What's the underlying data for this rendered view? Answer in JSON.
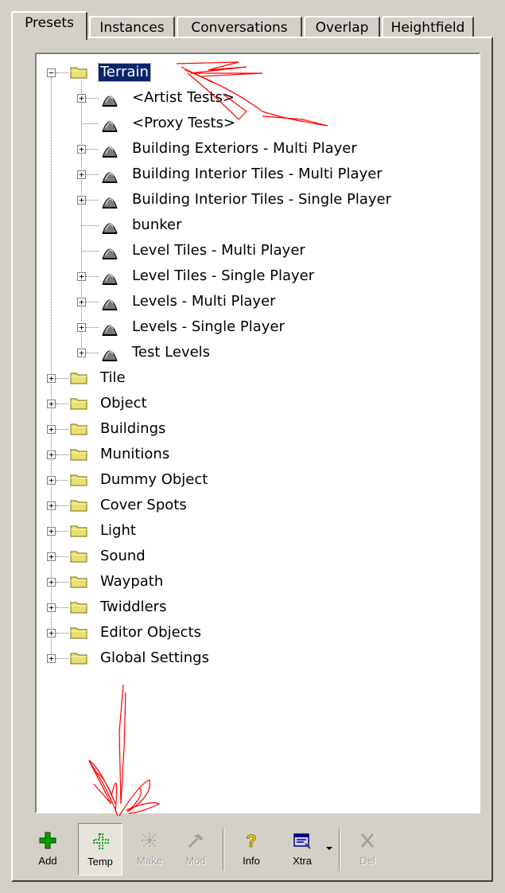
{
  "tabs": [
    {
      "label": "Presets",
      "active": true
    },
    {
      "label": "Instances",
      "active": false
    },
    {
      "label": "Conversations",
      "active": false
    },
    {
      "label": "Overlap",
      "active": false
    },
    {
      "label": "Heightfield",
      "active": false
    }
  ],
  "tree": {
    "root": {
      "label": "Terrain",
      "expanded": true,
      "selected": true
    },
    "terrain_children": [
      {
        "label": "<Artist Tests>",
        "expandable": true
      },
      {
        "label": "<Proxy Tests>",
        "expandable": false
      },
      {
        "label": "Building Exteriors - Multi Player",
        "expandable": true
      },
      {
        "label": "Building Interior Tiles - Multi Player",
        "expandable": true
      },
      {
        "label": "Building Interior Tiles - Single Player",
        "expandable": true
      },
      {
        "label": "bunker",
        "expandable": false
      },
      {
        "label": "Level Tiles - Multi Player",
        "expandable": false
      },
      {
        "label": "Level Tiles - Single Player",
        "expandable": true
      },
      {
        "label": "Levels - Multi Player",
        "expandable": true
      },
      {
        "label": "Levels - Single Player",
        "expandable": true
      },
      {
        "label": "Test Levels",
        "expandable": true
      }
    ],
    "top_folders": [
      "Tile",
      "Object",
      "Buildings",
      "Munitions",
      "Dummy Object",
      "Cover Spots",
      "Light",
      "Sound",
      "Waypath",
      "Twiddlers",
      "Editor Objects",
      "Global Settings"
    ]
  },
  "toolbar": [
    {
      "label": "Add",
      "icon": "add-icon",
      "enabled": true,
      "pressed": false
    },
    {
      "label": "Temp",
      "icon": "temp-icon",
      "enabled": true,
      "pressed": true
    },
    {
      "label": "Make",
      "icon": "make-icon",
      "enabled": false,
      "pressed": false
    },
    {
      "label": "Mod",
      "icon": "mod-icon",
      "enabled": false,
      "pressed": false
    },
    {
      "label": "Info",
      "icon": "info-icon",
      "enabled": true,
      "pressed": false
    },
    {
      "label": "Xtra",
      "icon": "xtra-icon",
      "enabled": true,
      "pressed": false
    },
    {
      "label": "Del",
      "icon": "delete-icon",
      "enabled": false,
      "pressed": false
    }
  ],
  "colors": {
    "selection": "#0a246a",
    "folder": "#e8e070",
    "annotation": "#ff0000",
    "add_icon": "#00a000"
  }
}
